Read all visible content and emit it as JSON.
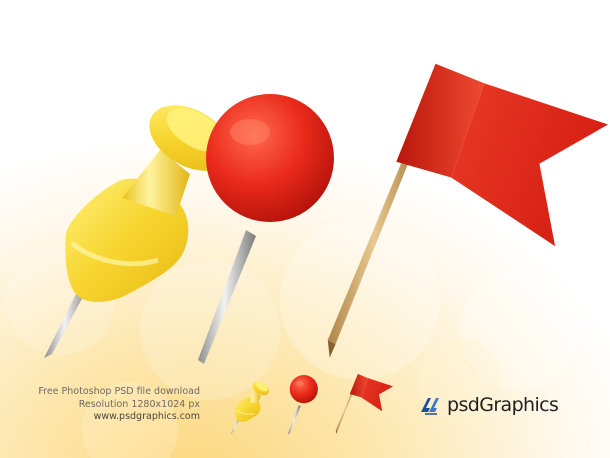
{
  "caption": {
    "line1": "Free Photoshop PSD file download",
    "line2": "Resolution 1280x1024 px",
    "url": "www.psdgraphics.com"
  },
  "brand": {
    "name": "psdGraphics"
  },
  "icons": {
    "large": [
      "yellow-push-pin-icon",
      "red-round-pin-icon",
      "red-flag-pin-icon"
    ],
    "small": [
      "yellow-push-pin-icon",
      "red-round-pin-icon",
      "red-flag-pin-icon"
    ]
  },
  "colors": {
    "pin_yellow": "#f5d12c",
    "pin_red": "#e8281c",
    "flag_red": "#e02a1a",
    "stick_wood": "#c9a468",
    "background_glow": "#fde7a8",
    "brand_blue": "#1d4f9c"
  }
}
